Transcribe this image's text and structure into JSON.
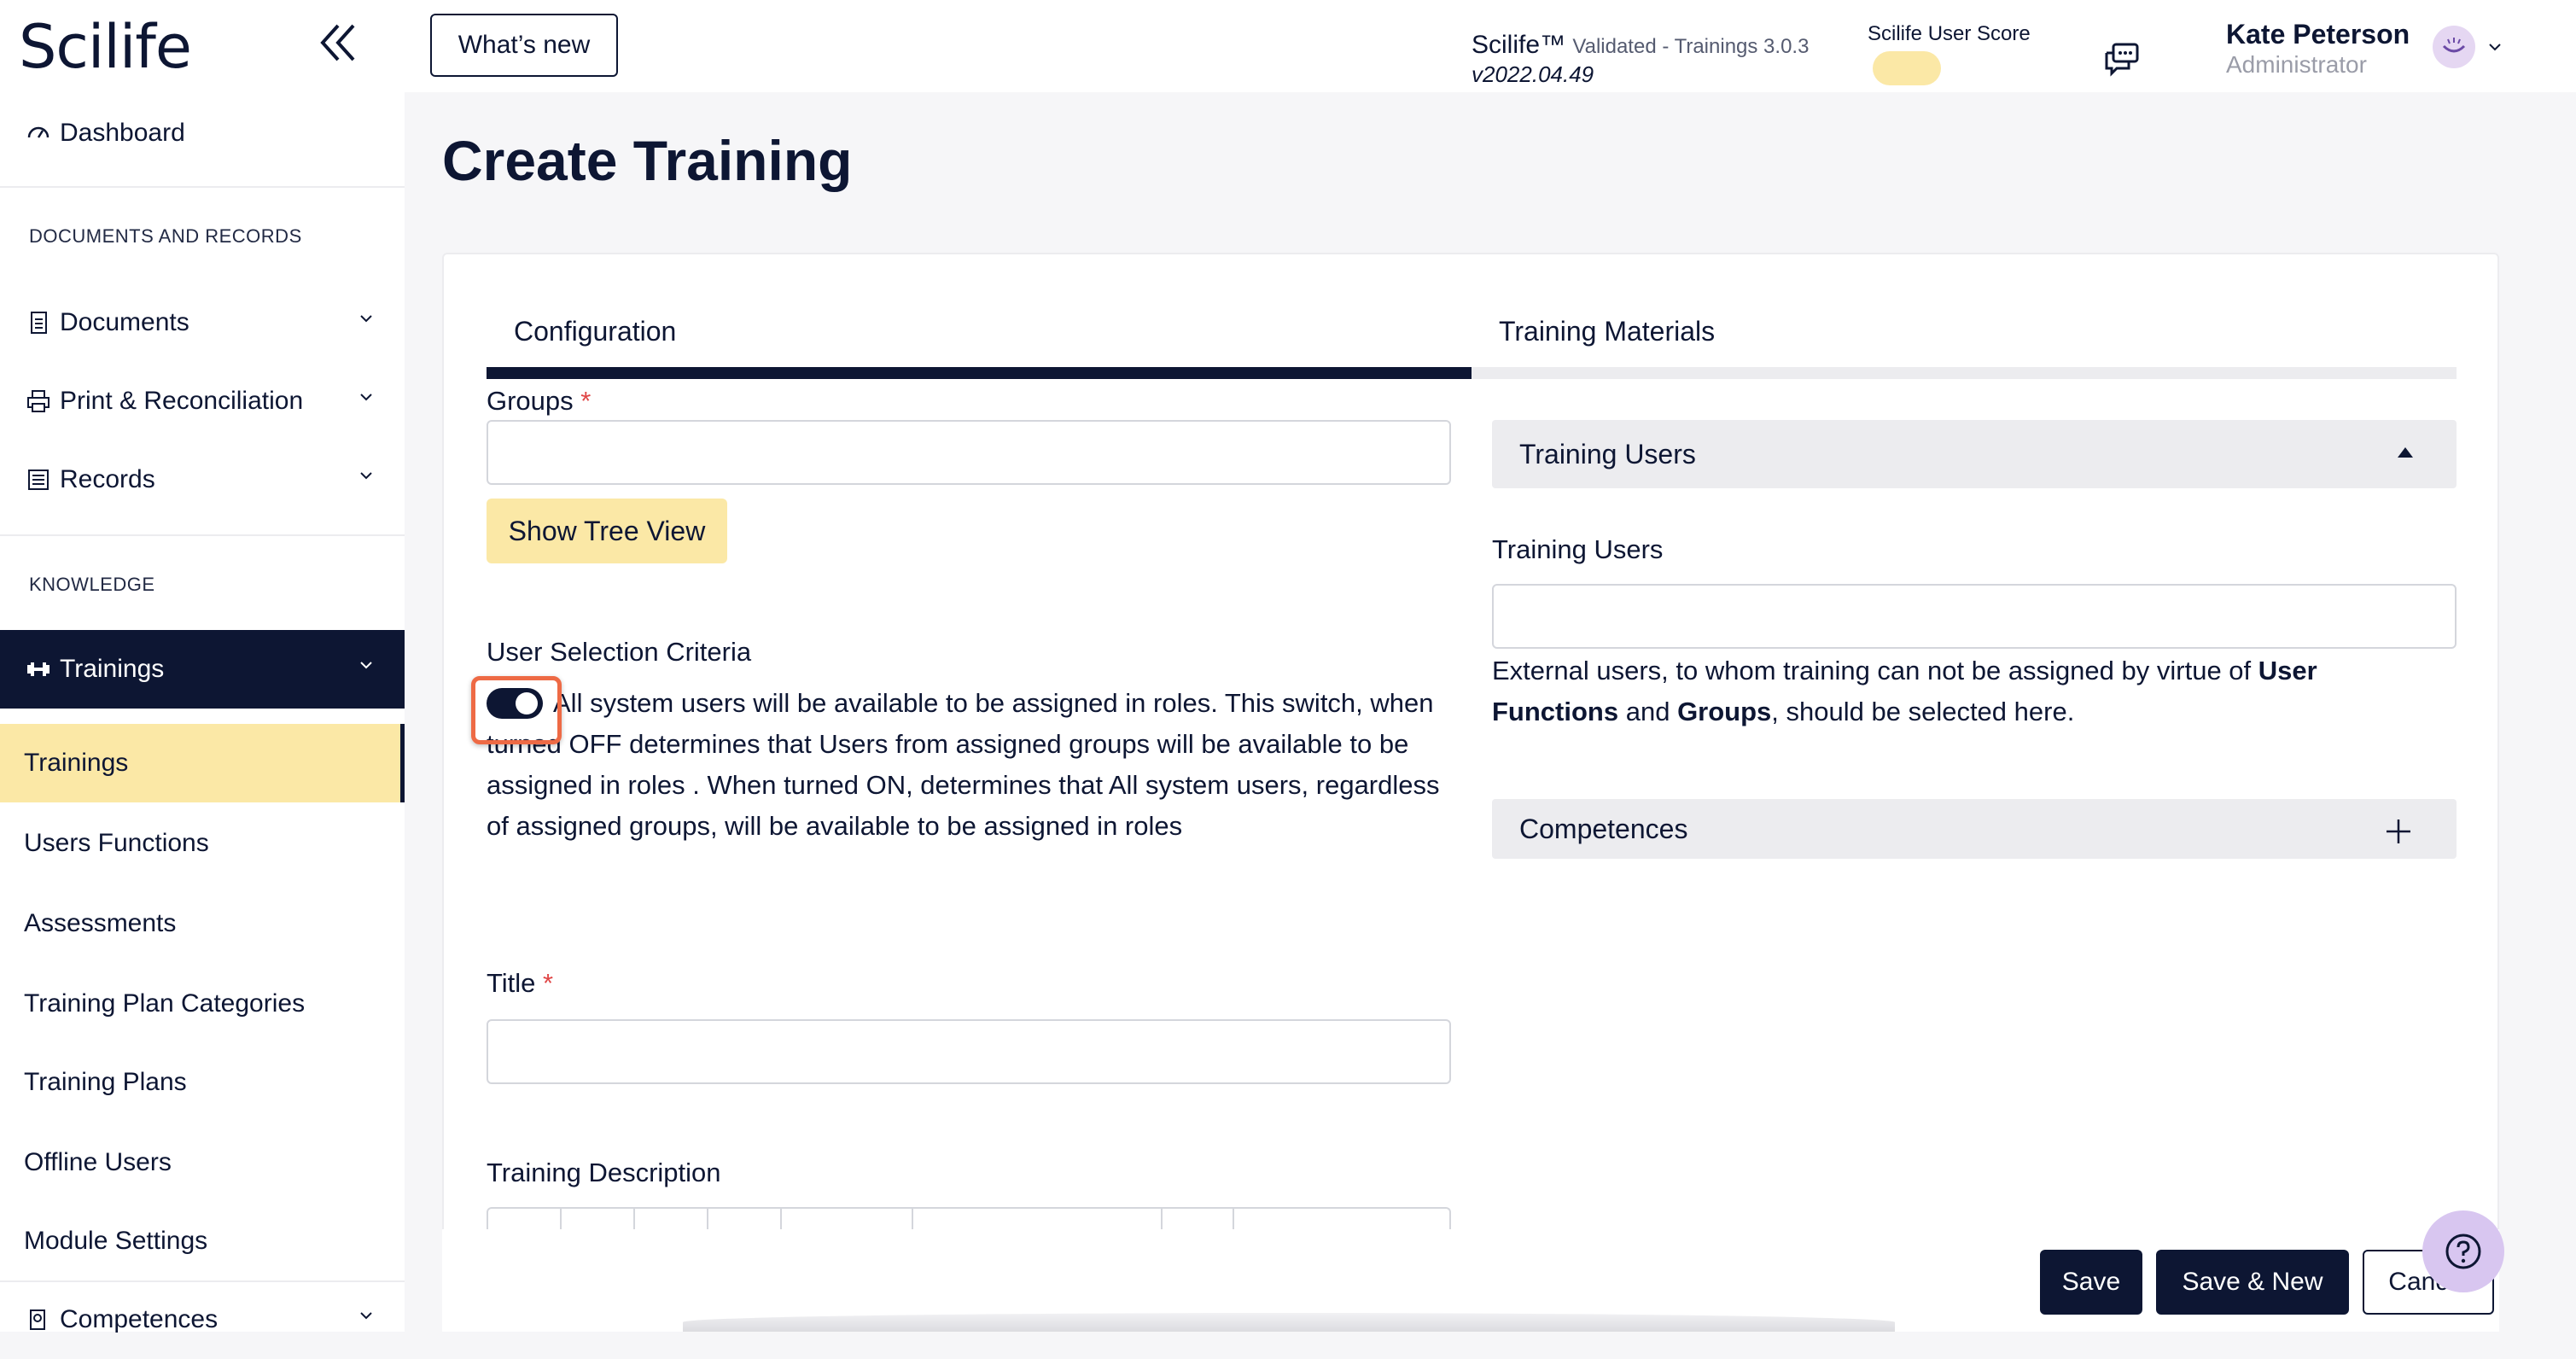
{
  "app": {
    "logo_text": "Scilife",
    "whats_new_label": "What’s new",
    "version_name": "Scilife™",
    "version_detail": "Validated - Trainings 3.0.3",
    "version_number": "v2022.04.49",
    "user_score_label": "Scilife User Score",
    "user_name": "Kate Peterson",
    "user_role": "Administrator",
    "accent_color": "#0d1633",
    "highlight_color": "#fbe8a6"
  },
  "sidebar": {
    "dashboard": "Dashboard",
    "section_docs": "DOCUMENTS AND RECORDS",
    "documents": "Documents",
    "print": "Print & Reconciliation",
    "records": "Records",
    "section_knowledge": "KNOWLEDGE",
    "trainings_group": "Trainings",
    "sub_items": [
      "Trainings",
      "Users Functions",
      "Assessments",
      "Training Plan Categories",
      "Training Plans",
      "Offline Users",
      "Module Settings"
    ],
    "competences": "Competences"
  },
  "page": {
    "title": "Create Training",
    "tabs": [
      "Configuration",
      "Training Materials"
    ],
    "groups_label": "Groups",
    "required_mark": "*",
    "groups_value": "",
    "show_tree_view": "Show Tree View",
    "user_selection_label": "User Selection Criteria",
    "toggle_description": "All system users will be available to be assigned in roles. This switch, when turned OFF determines that Users from assigned groups will be available to be assigned in roles . When turned ON, determines that All system users, regardless of assigned groups, will be available to be assigned in roles",
    "title_label": "Title",
    "title_value": "",
    "description_label": "Training Description",
    "training_users_panel": "Training Users",
    "training_users_label": "Training Users",
    "training_users_value": "",
    "external_note_prefix": "External users, to whom training can not be assigned by virtue of ",
    "external_note_bold1": "User Functions",
    "external_note_mid": " and ",
    "external_note_bold2": "Groups",
    "external_note_suffix": ", should be selected here.",
    "competences_panel": "Competences"
  },
  "footer": {
    "save": "Save",
    "save_new": "Save & New",
    "cancel": "Cancel"
  }
}
